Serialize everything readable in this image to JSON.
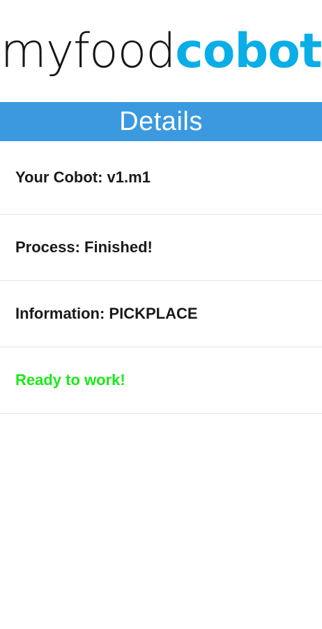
{
  "logo": {
    "part1": "myfood",
    "part2": "cobot",
    "part1_color": "#161616",
    "part2_color": "#0aaee6"
  },
  "header": {
    "title": "Details",
    "background": "#3b99e0"
  },
  "details": [
    {
      "text": "Your Cobot: v1.m1",
      "color": "#1a1a1a"
    },
    {
      "text": "Process: Finished!",
      "color": "#1a1a1a"
    },
    {
      "text": "Information: PICKPLACE",
      "color": "#1a1a1a"
    },
    {
      "text": "Ready to work!",
      "color": "#19ea19"
    }
  ]
}
